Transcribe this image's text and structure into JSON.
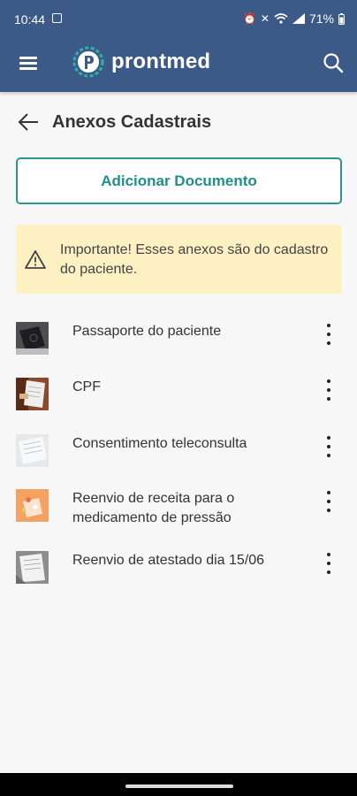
{
  "status_bar": {
    "time": "10:44",
    "battery": "71%",
    "battery_icon": "battery-icon",
    "signal_icon": "signal-icon",
    "wifi_icon": "wifi-icon",
    "mute_icon": "mute-icon",
    "alarm_icon": "alarm-icon"
  },
  "app_bar": {
    "logo_text": "prontmed",
    "menu_icon": "menu-icon",
    "search_icon": "search-icon",
    "color": "#3c5a87"
  },
  "page": {
    "title": "Anexos Cadastrais",
    "back_icon": "back-arrow-icon"
  },
  "add_button": {
    "label": "Adicionar Documento",
    "accent": "#28978f"
  },
  "alert": {
    "text": "Importante! Esses anexos são do cadastro do paciente.",
    "icon": "warning-icon",
    "background": "#fdf0c2"
  },
  "attachments": [
    {
      "label": "Passaporte do paciente",
      "thumb": "passport-thumbnail"
    },
    {
      "label": "CPF",
      "thumb": "document-thumbnail"
    },
    {
      "label": "Consentimento teleconsulta",
      "thumb": "paper-thumbnail"
    },
    {
      "label": "Reenvio de receita para o medicamento de pressão",
      "thumb": "prescription-thumbnail"
    },
    {
      "label": "Reenvio de atestado dia 15/06",
      "thumb": "certificate-thumbnail"
    }
  ]
}
